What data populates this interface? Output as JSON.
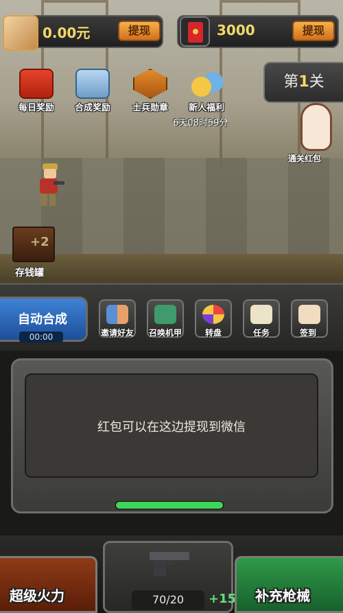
{
  "top": {
    "cash_amount": "0.00元",
    "withdraw_label": "提现",
    "redpack_amount": "3000",
    "redpack_withdraw_label": "提现"
  },
  "events": [
    {
      "label": "每日奖励",
      "icon": "daily-reward-icon"
    },
    {
      "label": "合成奖励",
      "icon": "merge-reward-icon"
    },
    {
      "label": "士兵勋章",
      "icon": "soldier-medal-icon"
    },
    {
      "label": "新人福利",
      "icon": "newbie-gift-icon"
    }
  ],
  "newbie_timer": "6天08时59分",
  "level": {
    "prefix": "第",
    "number": "1",
    "suffix": "关"
  },
  "level_reward_label": "通关红包",
  "piggy": {
    "plus": "+2",
    "label": "存钱罐"
  },
  "auto_merge": {
    "label": "自动合成",
    "timer": "00:00"
  },
  "tools": [
    {
      "label": "邀请好友",
      "icon": "invite-friends-icon"
    },
    {
      "label": "召唤机甲",
      "icon": "summon-mech-icon"
    },
    {
      "label": "转盘",
      "icon": "wheel-icon"
    },
    {
      "label": "任务",
      "icon": "task-icon"
    },
    {
      "label": "签到",
      "icon": "checkin-icon"
    }
  ],
  "panel_message": "红包可以在这边提现到微信",
  "progress_fraction": 1.0,
  "bottom": {
    "super_fire_label": "超级火力",
    "refill_label": "补充枪械",
    "ammo": "70/20",
    "ammo_plus": "+15"
  },
  "colors": {
    "gold_text": "#f4d96a",
    "withdraw_orange": "#f6b04a",
    "auto_blue": "#3f82d6",
    "progress_green": "#3ed65a",
    "refill_green": "#2f9a4a",
    "fire_red": "#8f3b17"
  }
}
